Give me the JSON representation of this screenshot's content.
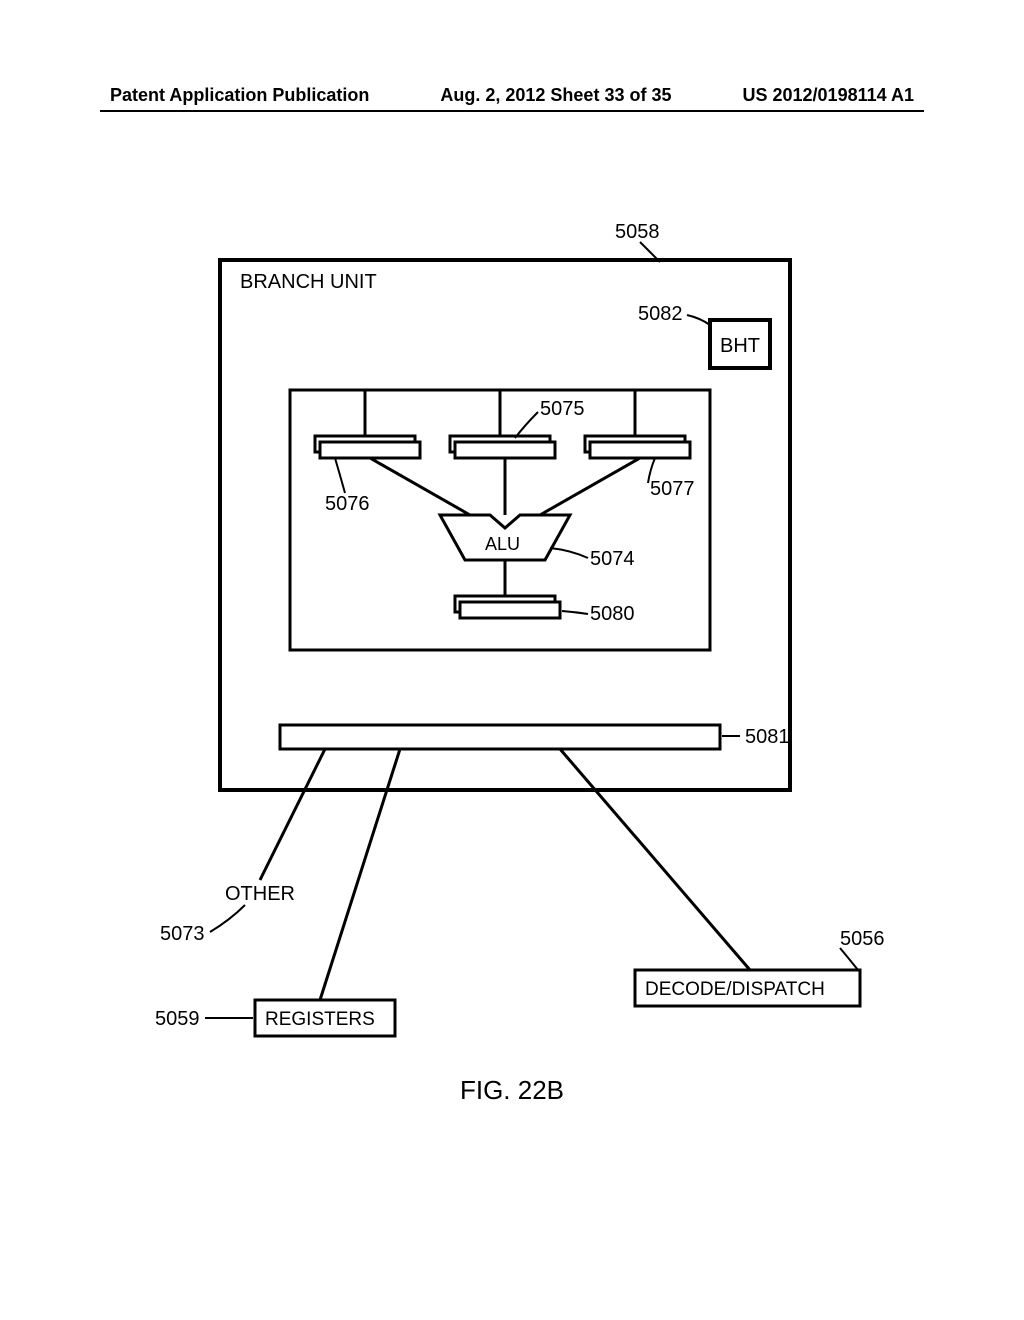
{
  "header": {
    "left": "Patent Application Publication",
    "center": "Aug. 2, 2012  Sheet 33 of 35",
    "right": "US 2012/0198114 A1"
  },
  "figure": {
    "title": "FIG. 22B",
    "branch_unit_label": "BRANCH UNIT",
    "alu_label": "ALU",
    "bht_label": "BHT",
    "other_label": "OTHER",
    "registers_label": "REGISTERS",
    "decode_label": "DECODE/DISPATCH"
  },
  "refs": {
    "r5058": "5058",
    "r5082": "5082",
    "r5075": "5075",
    "r5076": "5076",
    "r5077": "5077",
    "r5074": "5074",
    "r5080": "5080",
    "r5081": "5081",
    "r5073": "5073",
    "r5056": "5056",
    "r5059": "5059"
  }
}
